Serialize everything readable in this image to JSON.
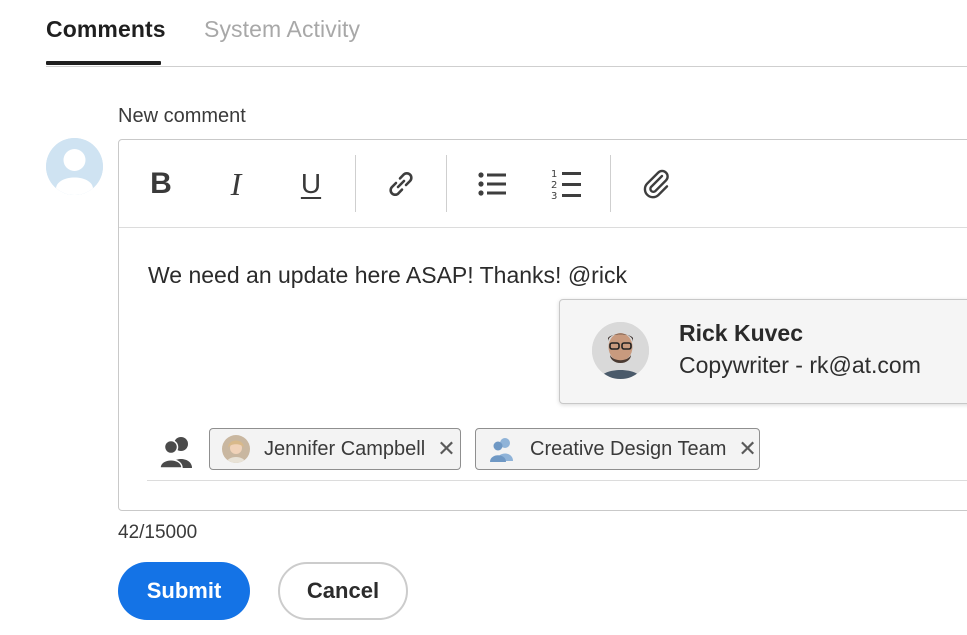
{
  "tabs": [
    {
      "label": "Comments",
      "active": true
    },
    {
      "label": "System Activity",
      "active": false
    }
  ],
  "composer": {
    "label": "New comment",
    "text": "We need an update here ASAP! Thanks! @rick",
    "counter": "42/15000",
    "toolbar": [
      "bold-icon",
      "italic-icon",
      "underline-icon",
      "link-icon",
      "bulleted-list-icon",
      "numbered-list-icon",
      "attachment-icon"
    ]
  },
  "mention": {
    "name": "Rick Kuvec",
    "role": "Copywriter - rk@at.com"
  },
  "recipients": [
    {
      "label": "Jennifer Campbell",
      "type": "user"
    },
    {
      "label": "Creative Design Team",
      "type": "team"
    }
  ],
  "actions": {
    "submit": "Submit",
    "cancel": "Cancel"
  },
  "colors": {
    "accent": "#1473e6",
    "text": "#2c2c2c",
    "muted": "#a8a8a8"
  }
}
